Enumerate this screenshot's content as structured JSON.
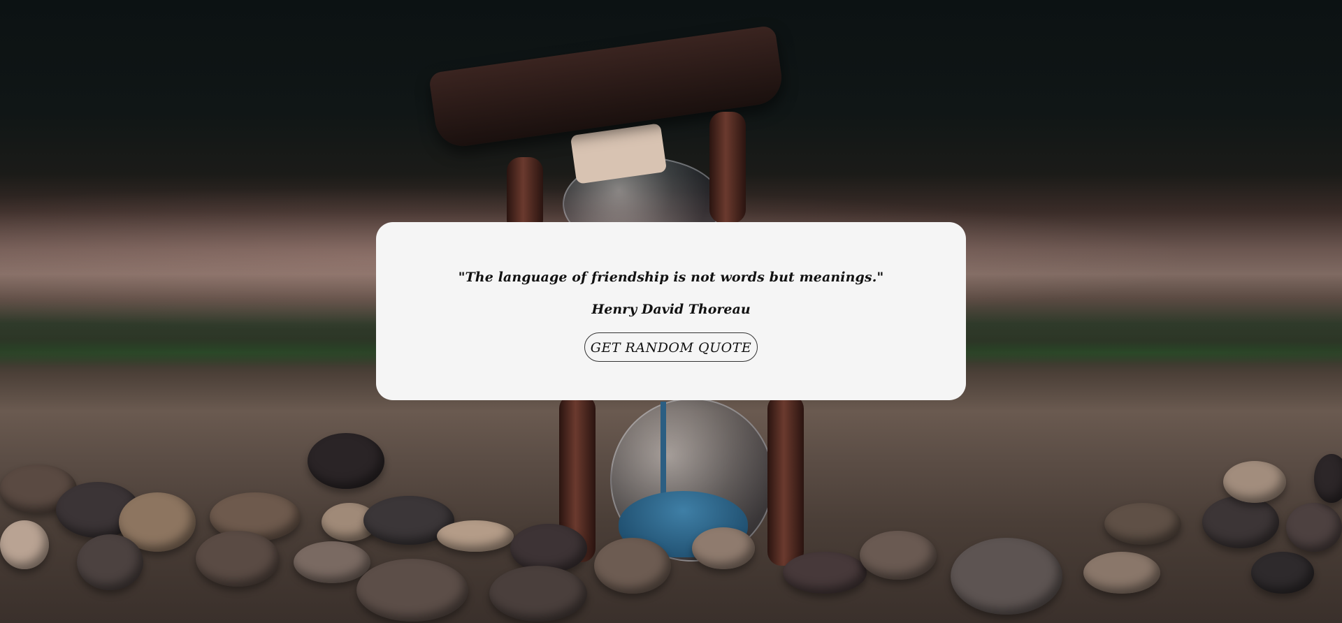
{
  "background": {
    "icon": "hourglass-on-pebbles-photo",
    "sand_color": "#2f6a92",
    "card_color": "#f5f5f5"
  },
  "quote": {
    "text": "\"The language of friendship is not words but meanings.\"",
    "author": "Henry David Thoreau"
  },
  "actions": {
    "random_quote_label": "GET RANDOM QUOTE"
  }
}
